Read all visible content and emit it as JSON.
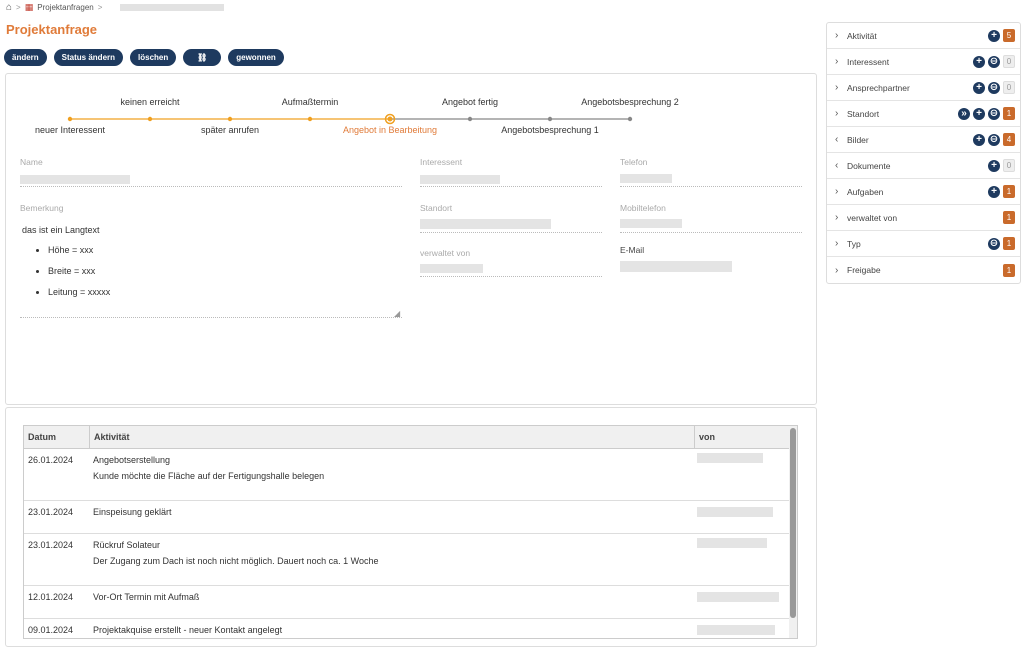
{
  "breadcrumb": {
    "item": "Projektanfragen",
    "sep": ">"
  },
  "page": {
    "title": "Projektanfrage"
  },
  "toolbar": {
    "edit": "ändern",
    "status": "Status ändern",
    "delete": "löschen",
    "link": "⛓",
    "won": "gewonnen"
  },
  "steps": [
    {
      "label": "neuer Interessent",
      "pos": "below",
      "state": "done"
    },
    {
      "label": "keinen erreicht",
      "pos": "above",
      "state": "done"
    },
    {
      "label": "später anrufen",
      "pos": "below",
      "state": "done"
    },
    {
      "label": "Aufmaßtermin",
      "pos": "above",
      "state": "done"
    },
    {
      "label": "Angebot in Bearbeitung",
      "pos": "below",
      "state": "current"
    },
    {
      "label": "Angebot fertig",
      "pos": "above",
      "state": "todo"
    },
    {
      "label": "Angebotsbesprechung 1",
      "pos": "below",
      "state": "todo"
    },
    {
      "label": "Angebotsbesprechung 2",
      "pos": "above",
      "state": "todo"
    }
  ],
  "colors": {
    "accent": "#e07b39",
    "progress_done": "#f0a020",
    "progress_todo": "#888888",
    "button": "#1e3a5f",
    "badge": "#c96a2b"
  },
  "fields": {
    "name": "Name",
    "remark": "Bemerkung",
    "interessent": "Interessent",
    "standort": "Standort",
    "verwaltet_von": "verwaltet von",
    "telefon": "Telefon",
    "mobiltelefon": "Mobiltelefon",
    "email": "E-Mail"
  },
  "remark": {
    "text": "das ist ein Langtext",
    "bullets": [
      "Höhe = xxx",
      "Breite = xxx",
      "Leitung = xxxxx"
    ]
  },
  "table": {
    "headers": [
      "Datum",
      "Aktivität",
      "von"
    ],
    "rows": [
      {
        "date": "26.01.2024",
        "title": "Angebotserstellung",
        "sub": "Kunde möchte die Fläche auf der Fertigungshalle belegen"
      },
      {
        "date": "23.01.2024",
        "title": "Einspeisung geklärt",
        "sub": ""
      },
      {
        "date": "23.01.2024",
        "title": "Rückruf Solateur",
        "sub": "Der Zugang zum Dach ist noch nicht möglich. Dauert noch ca. 1 Woche"
      },
      {
        "date": "12.01.2024",
        "title": "Vor-Ort Termin mit Aufmaß",
        "sub": ""
      },
      {
        "date": "09.01.2024",
        "title": "Projektakquise erstellt - neuer Kontakt angelegt",
        "sub": ""
      }
    ]
  },
  "sidebar": [
    {
      "label": "Aktivität",
      "chevron": "right",
      "icons": [
        "plus"
      ],
      "count": "5"
    },
    {
      "label": "Interessent",
      "chevron": "right",
      "icons": [
        "plus",
        "link"
      ],
      "count": "0"
    },
    {
      "label": "Ansprechpartner",
      "chevron": "right",
      "icons": [
        "plus",
        "link"
      ],
      "count": "0"
    },
    {
      "label": "Standort",
      "chevron": "right",
      "icons": [
        "forward",
        "plus",
        "link"
      ],
      "count": "1"
    },
    {
      "label": "Bilder",
      "chevron": "left",
      "icons": [
        "plus",
        "link"
      ],
      "count": "4"
    },
    {
      "label": "Dokumente",
      "chevron": "left",
      "icons": [
        "plus"
      ],
      "count": "0"
    },
    {
      "label": "Aufgaben",
      "chevron": "right",
      "icons": [
        "plus"
      ],
      "count": "1"
    },
    {
      "label": "verwaltet von",
      "chevron": "right",
      "icons": [],
      "count": "1"
    },
    {
      "label": "Typ",
      "chevron": "right",
      "icons": [
        "link"
      ],
      "count": "1"
    },
    {
      "label": "Freigabe",
      "chevron": "right",
      "icons": [],
      "count": "1"
    }
  ]
}
